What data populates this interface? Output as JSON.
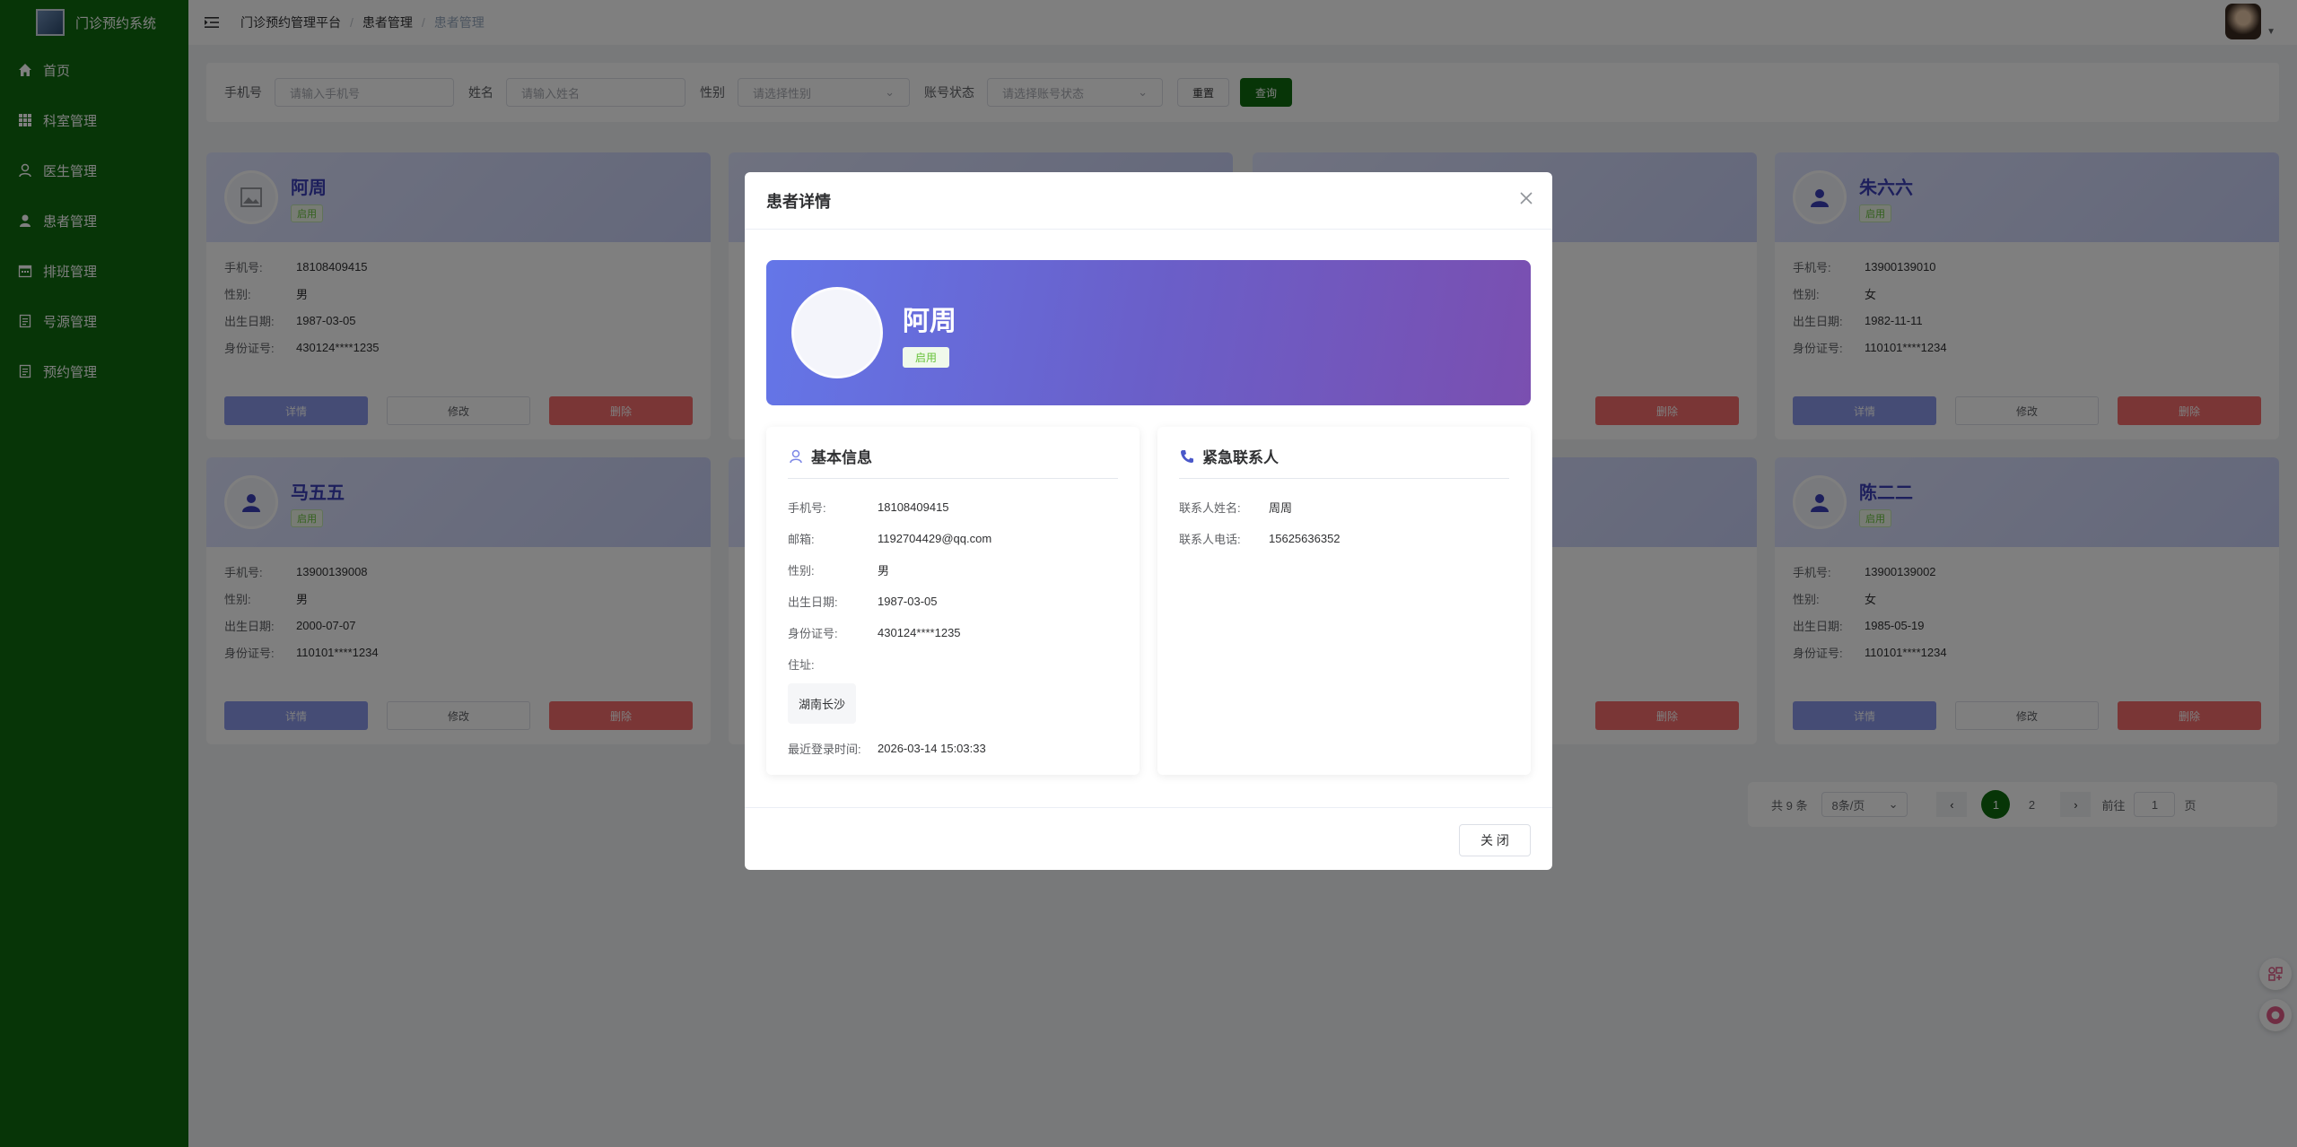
{
  "app": {
    "title": "门诊预约系统"
  },
  "sidebar": {
    "items": [
      {
        "label": "首页",
        "icon": "home-icon"
      },
      {
        "label": "科室管理",
        "icon": "grid-icon"
      },
      {
        "label": "医生管理",
        "icon": "user-icon"
      },
      {
        "label": "患者管理",
        "icon": "user-filled-icon"
      },
      {
        "label": "排班管理",
        "icon": "calendar-icon"
      },
      {
        "label": "号源管理",
        "icon": "document-icon"
      },
      {
        "label": "预约管理",
        "icon": "document-icon"
      }
    ]
  },
  "header": {
    "breadcrumb": [
      "门诊预约管理平台",
      "患者管理",
      "患者管理"
    ]
  },
  "search": {
    "phone_label": "手机号",
    "phone_placeholder": "请输入手机号",
    "name_label": "姓名",
    "name_placeholder": "请输入姓名",
    "gender_label": "性别",
    "gender_placeholder": "请选择性别",
    "status_label": "账号状态",
    "status_placeholder": "请选择账号状态",
    "reset_label": "重置",
    "query_label": "查询"
  },
  "card_labels": {
    "phone": "手机号:",
    "gender": "性别:",
    "birth": "出生日期:",
    "idcard": "身份证号:",
    "detail": "详情",
    "edit": "修改",
    "delete": "删除"
  },
  "cards": [
    {
      "name": "阿周",
      "status": "启用",
      "phone": "18108409415",
      "gender": "男",
      "birth": "1987-03-05",
      "idcard": "430124****1235"
    },
    {
      "name": "朱六六",
      "status": "启用",
      "phone": "13900139010",
      "gender": "女",
      "birth": "1982-11-11",
      "idcard": "110101****1234"
    },
    {
      "name": "马五五",
      "status": "启用",
      "phone": "13900139008",
      "gender": "男",
      "birth": "2000-07-07",
      "idcard": "110101****1234"
    },
    {
      "name": "陈二二",
      "status": "启用",
      "phone": "13900139002",
      "gender": "女",
      "birth": "1985-05-19",
      "idcard": "110101****1234"
    }
  ],
  "pagination": {
    "total_text": "共 9 条",
    "page_size": "8条/页",
    "pages": [
      "1",
      "2"
    ],
    "current": "1",
    "goto_label": "前往",
    "goto_value": "1",
    "page_unit": "页"
  },
  "dialog": {
    "title": "患者详情",
    "name": "阿周",
    "status": "启用",
    "basic_title": "基本信息",
    "basic": [
      {
        "k": "手机号:",
        "v": "18108409415"
      },
      {
        "k": "邮箱:",
        "v": "1192704429@qq.com"
      },
      {
        "k": "性别:",
        "v": "男"
      },
      {
        "k": "出生日期:",
        "v": "1987-03-05"
      },
      {
        "k": "身份证号:",
        "v": "430124****1235"
      }
    ],
    "address_label": "住址:",
    "address": "湖南长沙",
    "last_login_label": "最近登录时间:",
    "last_login": "2026-03-14 15:03:33",
    "emergency_title": "紧急联系人",
    "emergency": [
      {
        "k": "联系人姓名:",
        "v": "周周"
      },
      {
        "k": "联系人电话:",
        "v": "15625636352"
      }
    ],
    "close_label": "关 闭"
  },
  "colors": {
    "sidebar": "#0f6b0f",
    "primary": "#0f6b0f",
    "danger": "#f56c6c",
    "success": "#67c23a"
  }
}
